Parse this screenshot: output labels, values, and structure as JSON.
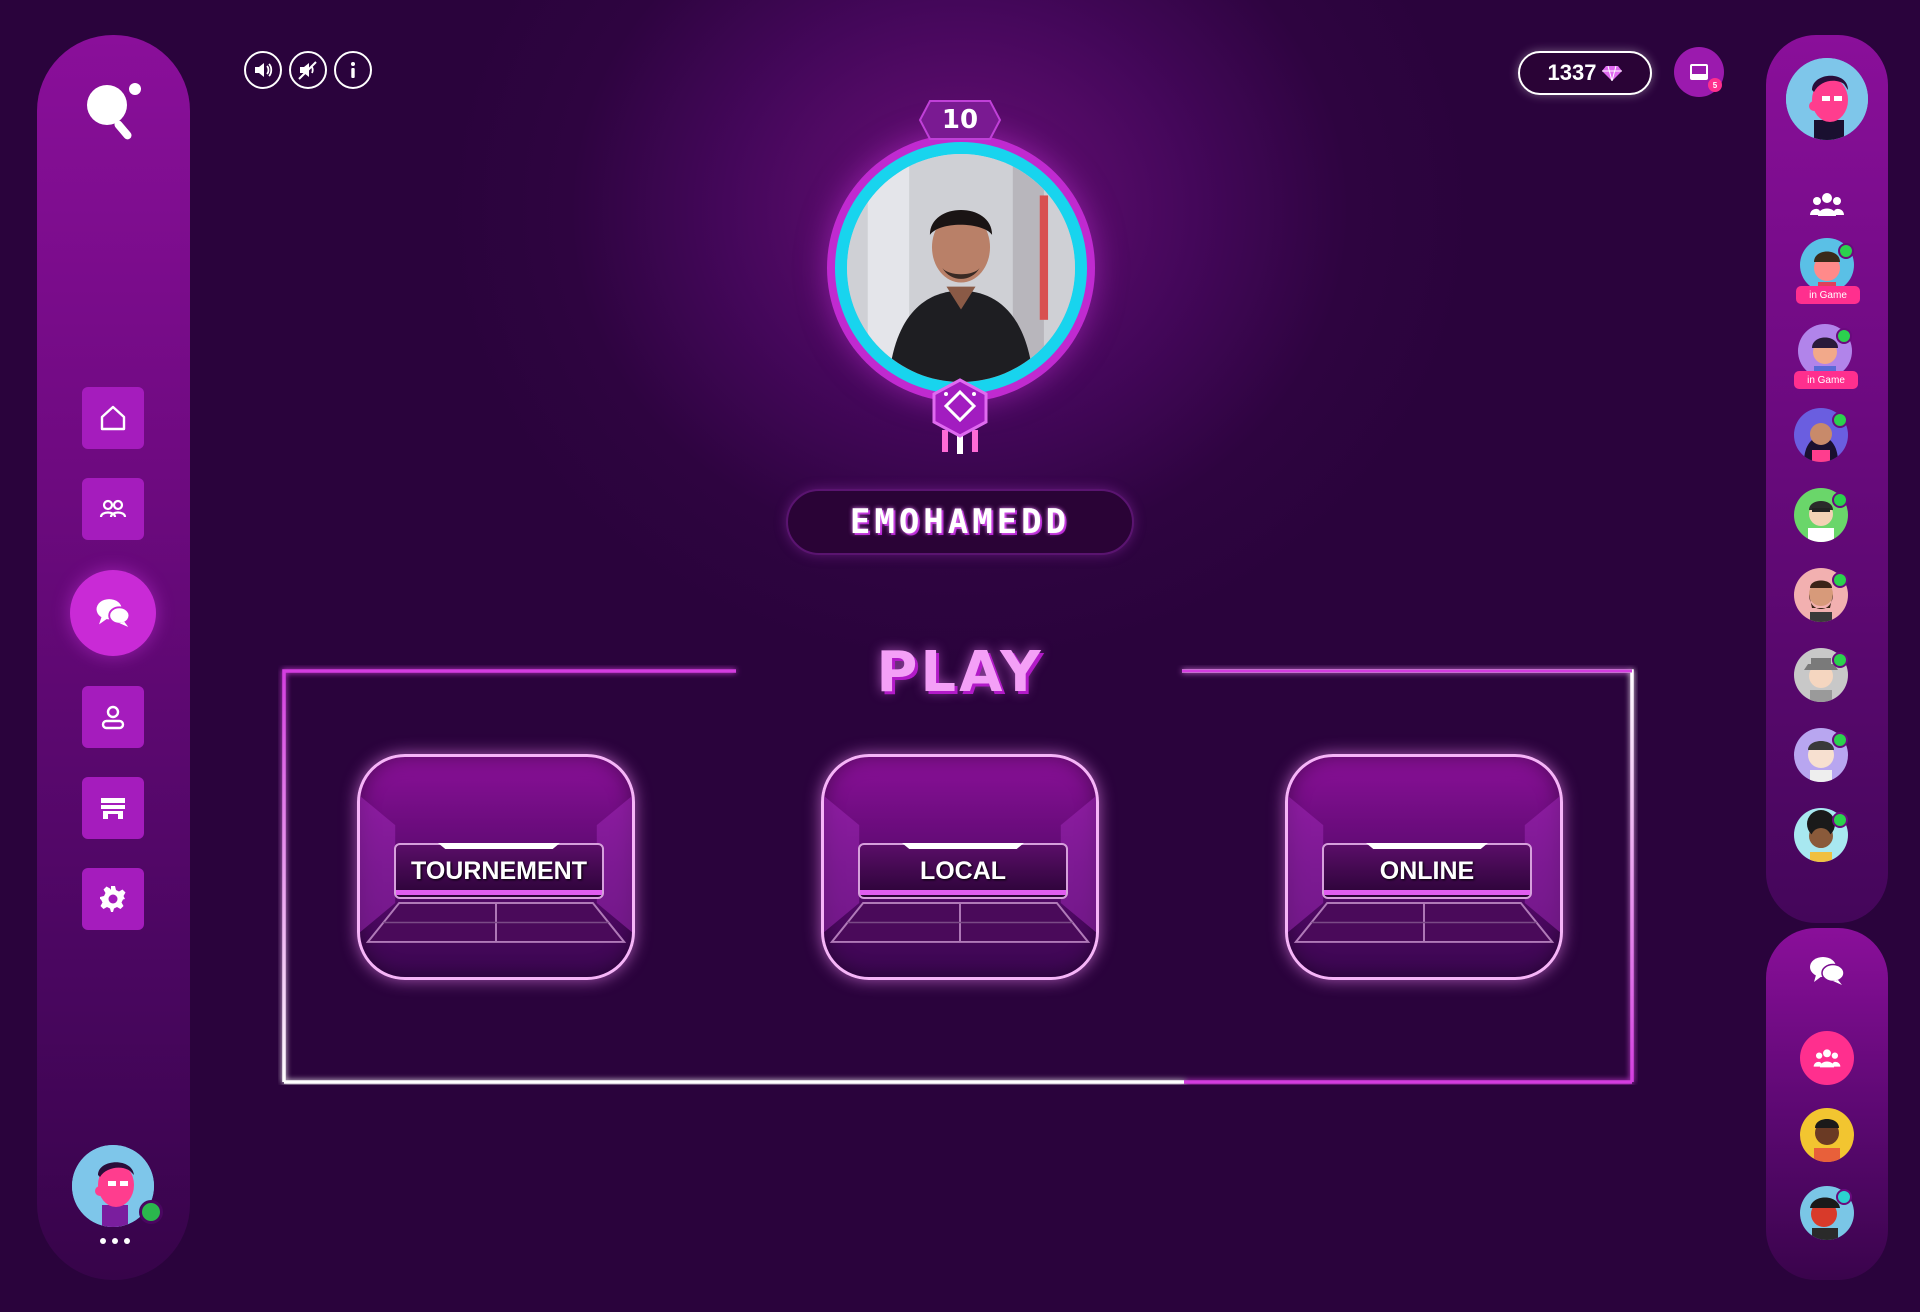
{
  "sidebar_left": {
    "items": [
      {
        "name": "home",
        "icon": "home-icon",
        "active": false
      },
      {
        "name": "friends",
        "icon": "users-icon",
        "active": false
      },
      {
        "name": "chat",
        "icon": "chat-icon",
        "active": true
      },
      {
        "name": "profile",
        "icon": "user-icon",
        "active": false
      },
      {
        "name": "store",
        "icon": "store-icon",
        "active": false
      },
      {
        "name": "settings",
        "icon": "gear-icon",
        "active": false
      }
    ]
  },
  "top_controls": [
    "sound-on-icon",
    "sound-off-icon",
    "info-icon"
  ],
  "header": {
    "coins": "1337",
    "coin_icon": "diamond-icon",
    "inbox_count": "5"
  },
  "profile": {
    "level": "10",
    "username": "EMOHAMEDD"
  },
  "play": {
    "title": "PLAY",
    "modes": [
      "TOURNEMENT",
      "LOCAL",
      "ONLINE"
    ]
  },
  "friends": [
    {
      "status_label": "in Game",
      "online": true
    },
    {
      "status_label": "in Game",
      "online": true
    },
    {
      "status_label": "",
      "online": true
    },
    {
      "status_label": "",
      "online": true
    },
    {
      "status_label": "",
      "online": true
    },
    {
      "status_label": "",
      "online": true
    },
    {
      "status_label": "",
      "online": true
    },
    {
      "status_label": "",
      "online": true
    }
  ],
  "colors": {
    "accent": "#c02ad0",
    "ring": "#18d4ee",
    "online": "#2bd14e",
    "badge": "#ff2f8e",
    "play_title": "#f4a0f7"
  }
}
